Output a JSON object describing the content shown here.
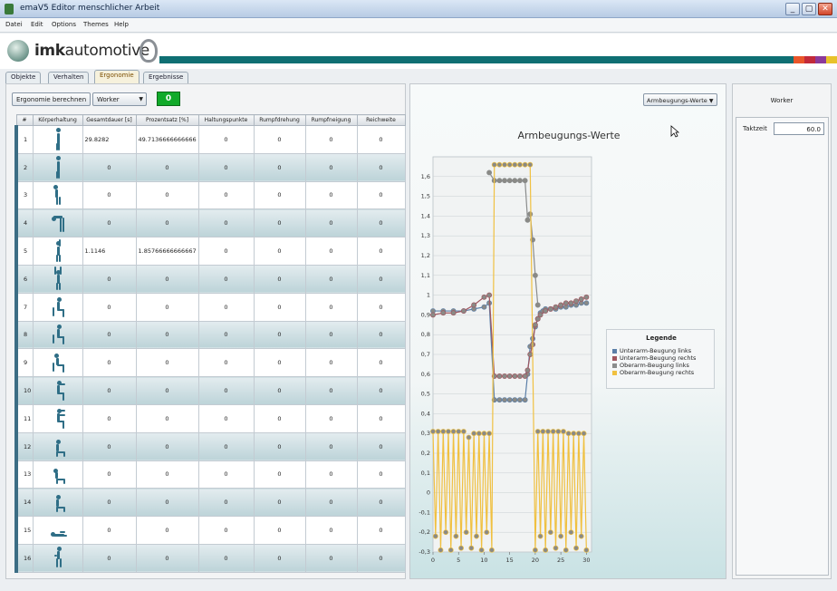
{
  "window": {
    "title": "emaV5 Editor menschlicher Arbeit",
    "controls": [
      "_",
      "▢",
      "✕"
    ]
  },
  "menu": [
    "Datei",
    "Edit",
    "Options",
    "Themes",
    "Help"
  ],
  "logo": {
    "text_bold": "imk",
    "text_thin": "automotive"
  },
  "brand_colors": [
    "#e9562a",
    "#c22a3a",
    "#8b3a9a",
    "#e8c22a"
  ],
  "tabs": [
    "Objekte",
    "Verhalten",
    "Ergonomie",
    "Ergebnisse"
  ],
  "active_tab": "Ergonomie",
  "toolbar": {
    "calc_button": "Ergonomie berechnen",
    "worker_select": "Worker",
    "counter": "0"
  },
  "table": {
    "headers": [
      "#",
      "Körperhaltung",
      "Gesamtdauer [s]",
      "Prozentsatz [%]",
      "Haltungspunkte",
      "Rumpfdrehung",
      "Rumpfneigung",
      "Reichweite"
    ],
    "rows": [
      {
        "n": "1",
        "pose": "stand",
        "dauer": "29.8282",
        "prozent": "49.7136666666666",
        "hp": "0",
        "rd": "0",
        "rn": "0",
        "rw": "0"
      },
      {
        "n": "2",
        "pose": "stand",
        "dauer": "0",
        "prozent": "0",
        "hp": "0",
        "rd": "0",
        "rn": "0",
        "rw": "0"
      },
      {
        "n": "3",
        "pose": "bend",
        "dauer": "0",
        "prozent": "0",
        "hp": "0",
        "rd": "0",
        "rn": "0",
        "rw": "0"
      },
      {
        "n": "4",
        "pose": "deepbend",
        "dauer": "0",
        "prozent": "0",
        "hp": "0",
        "rd": "0",
        "rn": "0",
        "rw": "0"
      },
      {
        "n": "5",
        "pose": "armup",
        "dauer": "1.1146",
        "prozent": "1.85766666666667",
        "hp": "0",
        "rd": "0",
        "rn": "0",
        "rw": "0"
      },
      {
        "n": "6",
        "pose": "armsup",
        "dauer": "0",
        "prozent": "0",
        "hp": "0",
        "rd": "0",
        "rn": "0",
        "rw": "0"
      },
      {
        "n": "7",
        "pose": "sit",
        "dauer": "0",
        "prozent": "0",
        "hp": "0",
        "rd": "0",
        "rn": "0",
        "rw": "0"
      },
      {
        "n": "8",
        "pose": "sit",
        "dauer": "0",
        "prozent": "0",
        "hp": "0",
        "rd": "0",
        "rn": "0",
        "rw": "0"
      },
      {
        "n": "9",
        "pose": "sitbend",
        "dauer": "0",
        "prozent": "0",
        "hp": "0",
        "rd": "0",
        "rn": "0",
        "rw": "0"
      },
      {
        "n": "10",
        "pose": "sitarm",
        "dauer": "0",
        "prozent": "0",
        "hp": "0",
        "rd": "0",
        "rn": "0",
        "rw": "0"
      },
      {
        "n": "11",
        "pose": "sitarms",
        "dauer": "0",
        "prozent": "0",
        "hp": "0",
        "rd": "0",
        "rn": "0",
        "rw": "0"
      },
      {
        "n": "12",
        "pose": "kneel",
        "dauer": "0",
        "prozent": "0",
        "hp": "0",
        "rd": "0",
        "rn": "0",
        "rw": "0"
      },
      {
        "n": "13",
        "pose": "kneelbend",
        "dauer": "0",
        "prozent": "0",
        "hp": "0",
        "rd": "0",
        "rn": "0",
        "rw": "0"
      },
      {
        "n": "14",
        "pose": "kneel",
        "dauer": "0",
        "prozent": "0",
        "hp": "0",
        "rd": "0",
        "rn": "0",
        "rw": "0"
      },
      {
        "n": "15",
        "pose": "lie",
        "dauer": "0",
        "prozent": "0",
        "hp": "0",
        "rd": "0",
        "rn": "0",
        "rw": "0"
      },
      {
        "n": "16",
        "pose": "crouch",
        "dauer": "0",
        "prozent": "0",
        "hp": "0",
        "rd": "0",
        "rn": "0",
        "rw": "0"
      }
    ]
  },
  "chart_select": "Armbeugungs-Werte",
  "chart_data": {
    "type": "line",
    "title": "Armbeugungs-Werte",
    "xlabel": "",
    "ylabel": "",
    "xlim": [
      0,
      31
    ],
    "ylim": [
      -0.3,
      1.7
    ],
    "xticks": [
      0,
      5,
      10,
      15,
      20,
      25,
      30
    ],
    "yticks": [
      -0.3,
      -0.2,
      -0.1,
      0,
      0.1,
      0.2,
      0.3,
      0.4,
      0.5,
      0.6,
      0.7,
      0.8,
      0.9,
      1,
      1.1,
      1.2,
      1.3,
      1.4,
      1.5,
      1.6
    ],
    "legend_title": "Legende",
    "legend_position": "right",
    "series": [
      {
        "name": "Unterarm-Beugung links",
        "color": "#5b7fa8",
        "x": [
          0,
          2,
          4,
          6,
          8,
          10,
          11,
          12,
          13,
          14,
          15,
          16,
          17,
          18,
          18.5,
          19,
          19.5,
          20,
          20.5,
          21,
          21.5,
          22,
          23,
          24,
          25,
          26,
          27,
          28,
          29,
          30
        ],
        "y": [
          0.92,
          0.92,
          0.92,
          0.92,
          0.93,
          0.94,
          0.96,
          0.47,
          0.47,
          0.47,
          0.47,
          0.47,
          0.47,
          0.47,
          0.6,
          0.74,
          0.78,
          0.84,
          0.88,
          0.91,
          0.92,
          0.93,
          0.93,
          0.93,
          0.94,
          0.94,
          0.95,
          0.95,
          0.96,
          0.96
        ]
      },
      {
        "name": "Unterarm-Beugung rechts",
        "color": "#a0565f",
        "x": [
          0,
          2,
          4,
          6,
          8,
          10,
          11,
          12,
          13,
          14,
          15,
          16,
          17,
          18,
          18.5,
          19,
          19.5,
          20,
          20.5,
          21,
          22,
          23,
          24,
          25,
          26,
          27,
          28,
          29,
          30
        ],
        "y": [
          0.9,
          0.91,
          0.91,
          0.92,
          0.95,
          0.99,
          1.0,
          0.59,
          0.59,
          0.59,
          0.59,
          0.59,
          0.59,
          0.59,
          0.62,
          0.7,
          0.75,
          0.85,
          0.88,
          0.9,
          0.92,
          0.93,
          0.94,
          0.95,
          0.96,
          0.96,
          0.97,
          0.98,
          0.99
        ]
      },
      {
        "name": "Oberarm-Beugung links",
        "color": "#8a8c8c",
        "x": [
          11,
          12,
          13,
          14,
          15,
          16,
          17,
          18,
          18.5,
          19,
          19.5,
          20,
          20.5
        ],
        "y": [
          1.62,
          1.58,
          1.58,
          1.58,
          1.58,
          1.58,
          1.58,
          1.58,
          1.38,
          1.41,
          1.28,
          1.1,
          0.95
        ]
      },
      {
        "name": "Oberarm-Beugung rechts",
        "color": "#f0c040",
        "x": [
          0,
          0.5,
          1,
          1.5,
          2,
          2.5,
          3,
          3.5,
          4,
          4.5,
          5,
          5.5,
          6,
          6.5,
          7,
          7.5,
          8,
          8.5,
          9,
          9.5,
          10,
          10.5,
          11,
          11.5,
          12,
          13,
          14,
          15,
          16,
          17,
          18,
          19,
          20,
          20.5,
          21,
          21.5,
          22,
          22.5,
          23,
          23.5,
          24,
          24.5,
          25,
          25.5,
          26,
          26.5,
          27,
          27.5,
          28,
          28.5,
          29,
          29.5,
          30
        ],
        "y": [
          0.31,
          -0.22,
          0.31,
          -0.29,
          0.31,
          -0.2,
          0.31,
          -0.29,
          0.31,
          -0.22,
          0.31,
          -0.28,
          0.31,
          -0.2,
          0.28,
          -0.28,
          0.3,
          -0.22,
          0.3,
          -0.29,
          0.3,
          -0.2,
          0.3,
          -0.29,
          1.66,
          1.66,
          1.66,
          1.66,
          1.66,
          1.66,
          1.66,
          1.66,
          -0.29,
          0.31,
          -0.22,
          0.31,
          -0.29,
          0.31,
          -0.2,
          0.31,
          -0.28,
          0.31,
          -0.22,
          0.31,
          -0.29,
          0.3,
          -0.2,
          0.3,
          -0.28,
          0.3,
          -0.22,
          0.3,
          -0.29
        ]
      }
    ]
  },
  "right_panel": {
    "title": "Worker",
    "taktzeit_label": "Taktzeit",
    "taktzeit_value": "60.0"
  }
}
